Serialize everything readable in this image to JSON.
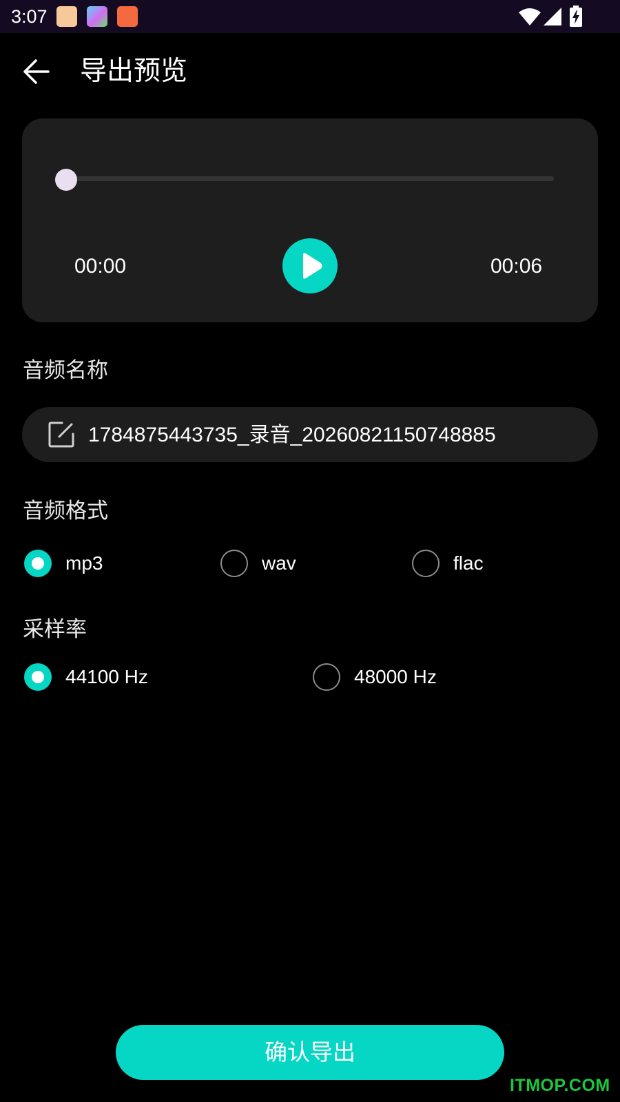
{
  "status_bar": {
    "time": "3:07",
    "notification_icons": [
      "cat-app-icon",
      "rainbow-app-icon",
      "book-app-icon"
    ],
    "right_icons": [
      "wifi-icon",
      "cellular-signal-icon",
      "battery-charging-icon"
    ]
  },
  "header": {
    "title": "导出预览",
    "back_icon": "arrow-left-icon"
  },
  "player": {
    "current_time": "00:00",
    "total_time": "00:06",
    "progress": 0,
    "play_icon": "play-icon"
  },
  "audio_name": {
    "label": "音频名称",
    "value": "1784875443735_录音_20260821150748885",
    "icon": "edit-icon"
  },
  "audio_format": {
    "label": "音频格式",
    "options": [
      {
        "label": "mp3",
        "checked": true
      },
      {
        "label": "wav",
        "checked": false
      },
      {
        "label": "flac",
        "checked": false
      }
    ]
  },
  "sample_rate": {
    "label": "采样率",
    "options": [
      {
        "label": "44100 Hz",
        "checked": true
      },
      {
        "label": "48000 Hz",
        "checked": false
      }
    ]
  },
  "confirm_button": {
    "label": "确认导出"
  },
  "watermark": "ITMOP.COM",
  "colors": {
    "accent": "#06d6c4",
    "background": "#000000",
    "card": "#1e1e1e",
    "status_bar": "#140a22"
  }
}
